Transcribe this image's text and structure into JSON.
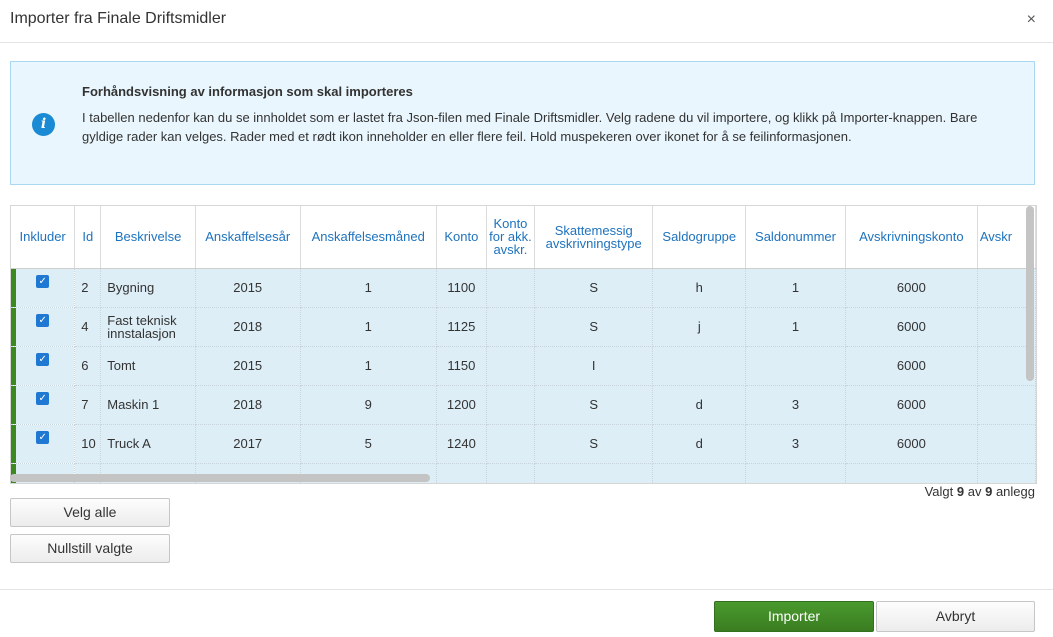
{
  "dialog": {
    "title": "Importer fra Finale Driftsmidler",
    "close_glyph": "×"
  },
  "info": {
    "icon": "info-icon",
    "icon_glyph": "i",
    "title": "Forhåndsvisning av informasjon som skal importeres",
    "text": "I tabellen nedenfor kan du se innholdet som er lastet fra Json-filen med Finale Driftsmidler. Velg radene du vil importere, og klikk på Importer-knappen. Bare gyldige rader kan velges. Rader med et rødt ikon inneholder en eller flere feil. Hold muspekeren over ikonet for å se feilinformasjonen."
  },
  "table": {
    "headers": {
      "include": "Inkluder",
      "id": "Id",
      "description": "Beskrivelse",
      "year": "Anskaffelsesår",
      "month": "Anskaffelsesmåned",
      "account": "Konto",
      "acc_depr": "Konto for akk. avskr.",
      "tax_depr": "Skattemessig avskrivningstype",
      "balance_group": "Saldogruppe",
      "balance_number": "Saldonummer",
      "depr_account": "Avskrivningskonto",
      "depr_cut": "Avskr"
    },
    "rows": [
      {
        "checked": "✓",
        "id": "2",
        "description": "Bygning",
        "year": "2015",
        "month": "1",
        "account": "1100",
        "acc_depr": "",
        "tax_depr": "S",
        "balance_group": "h",
        "balance_number": "1",
        "depr_account": "6000"
      },
      {
        "checked": "✓",
        "id": "4",
        "description": "Fast teknisk innstalasjon",
        "year": "2018",
        "month": "1",
        "account": "1125",
        "acc_depr": "",
        "tax_depr": "S",
        "balance_group": "j",
        "balance_number": "1",
        "depr_account": "6000"
      },
      {
        "checked": "✓",
        "id": "6",
        "description": "Tomt",
        "year": "2015",
        "month": "1",
        "account": "1150",
        "acc_depr": "",
        "tax_depr": "I",
        "balance_group": "",
        "balance_number": "",
        "depr_account": "6000"
      },
      {
        "checked": "✓",
        "id": "7",
        "description": "Maskin 1",
        "year": "2018",
        "month": "9",
        "account": "1200",
        "acc_depr": "",
        "tax_depr": "S",
        "balance_group": "d",
        "balance_number": "3",
        "depr_account": "6000"
      },
      {
        "checked": "✓",
        "id": "10",
        "description": "Truck A",
        "year": "2017",
        "month": "5",
        "account": "1240",
        "acc_depr": "",
        "tax_depr": "S",
        "balance_group": "d",
        "balance_number": "3",
        "depr_account": "6000"
      },
      {
        "checked": "",
        "id": "",
        "description": "",
        "year": "",
        "month": "",
        "account": "",
        "acc_depr": "",
        "tax_depr": "",
        "balance_group": "",
        "balance_number": "",
        "depr_account": ""
      }
    ]
  },
  "selection": {
    "prefix": "Valgt",
    "selected": "9",
    "of": "av",
    "total": "9",
    "suffix": "anlegg"
  },
  "buttons": {
    "select_all": "Velg alle",
    "reset": "Nullstill valgte",
    "import": "Importer",
    "cancel": "Avbryt"
  },
  "colors": {
    "accent": "#1e73be",
    "primary_button": "#3a7d21",
    "row_marker": "#3c8a1f",
    "info_background": "#e9f6fd"
  }
}
